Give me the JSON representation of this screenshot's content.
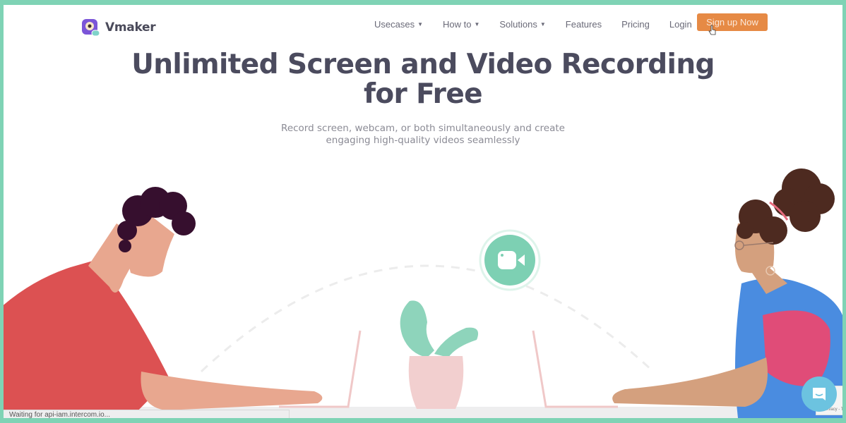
{
  "brand": {
    "name": "Vmaker",
    "accent_color": "#e68a45",
    "frame_color": "#7fd3b5"
  },
  "nav": {
    "items": [
      {
        "label": "Usecases",
        "has_dropdown": true
      },
      {
        "label": "How to",
        "has_dropdown": true
      },
      {
        "label": "Solutions",
        "has_dropdown": true
      },
      {
        "label": "Features",
        "has_dropdown": false
      },
      {
        "label": "Pricing",
        "has_dropdown": false
      },
      {
        "label": "Login",
        "has_dropdown": false
      }
    ],
    "cta_label": "Sign up Now"
  },
  "hero": {
    "title_line1": "Unlimited Screen and Video Recording",
    "title_line2": "for Free",
    "subtitle_line1": "Record screen, webcam, or both simultaneously and create",
    "subtitle_line2": "engaging high-quality videos seamlessly"
  },
  "illustration": {
    "center_icon": "video-camera-icon",
    "center_icon_color": "#7dd0b3"
  },
  "status_bar": {
    "text": "Waiting for api-iam.intercom.io..."
  },
  "recaptcha": {
    "text": "Privacy - Terms"
  },
  "chat": {
    "icon": "chat-bubble-icon"
  }
}
